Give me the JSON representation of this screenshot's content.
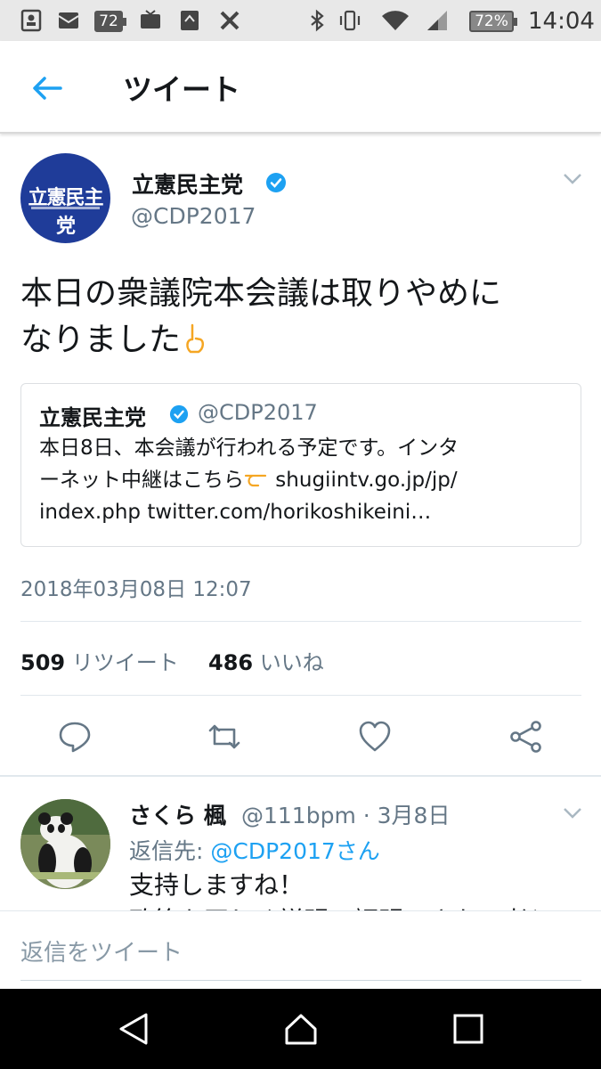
{
  "status_bar": {
    "notification_badge": "72",
    "battery": "72%",
    "time": "14:04",
    "icons": [
      "contacts-icon",
      "mail-icon",
      "badge-icon",
      "tv-icon",
      "file-icon",
      "tools-icon",
      "bluetooth-icon",
      "vibrate-icon",
      "wifi-icon",
      "signal-icon",
      "battery-icon"
    ]
  },
  "header": {
    "title": "ツイート",
    "back_icon": "back-arrow-icon"
  },
  "tweet": {
    "author_name": "立憲民主党",
    "author_handle": "@CDP2017",
    "avatar_text": "立憲民主党",
    "text_line1": "本日の衆議院本会議は取りやめに",
    "text_line2": "なりました",
    "emoji": "pointing-up-hand-icon",
    "quoted": {
      "author_name": "立憲民主党",
      "author_handle": "@CDP2017",
      "line1": "本日8日、本会議が行われる予定です。インタ",
      "line2_before": "ーネット中継はこちら",
      "line2_after": " shugiintv.go.jp/jp/",
      "line3": "index.php twitter.com/horikoshikeini…"
    },
    "date": "2018年03月08日 12:07",
    "retweet_count": "509",
    "retweet_label": "リツイート",
    "like_count": "486",
    "like_label": "いいね"
  },
  "reply": {
    "author_name": "さくら 楓",
    "meta": "@111bpm · 3月8日",
    "reply_to_label": "返信先: ",
    "reply_to_mention": "@CDP2017さん",
    "text_line1": "支持しますね！",
    "text_line2": "政策を正しく説明、証明できない者との"
  },
  "compose": {
    "placeholder": "返信をツイート"
  },
  "colors": {
    "accent": "#1da1f2",
    "secondary_text": "#657786",
    "cdp_blue": "#1f3c99"
  }
}
